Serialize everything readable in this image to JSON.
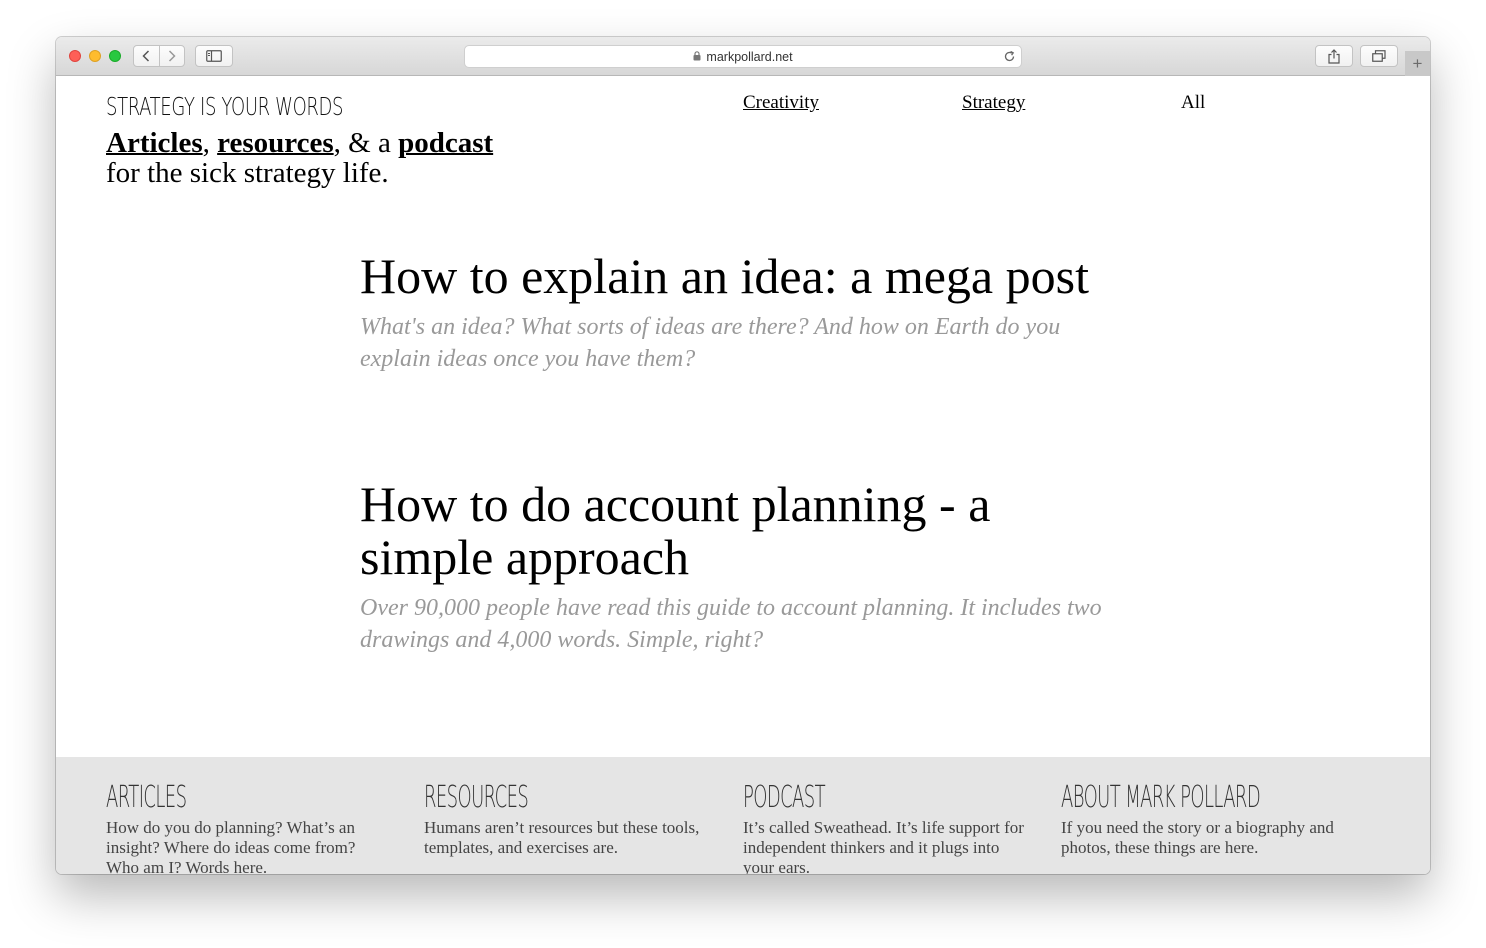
{
  "browser": {
    "url": "markpollard.net"
  },
  "site": {
    "logo": "Strategy is your words",
    "tagline": {
      "link1": "Articles",
      "sep1": ", ",
      "link2": "resources",
      "sep2": ", & a ",
      "link3": "podcast",
      "line2": "for the sick strategy life."
    }
  },
  "nav": {
    "items": [
      {
        "label": "Creativity"
      },
      {
        "label": "Strategy"
      },
      {
        "label": "All"
      }
    ]
  },
  "articles": [
    {
      "title": "How to explain an idea: a mega post",
      "summary": "What's an idea? What sorts of ideas are there? And how on Earth do you explain ideas once you have them?"
    },
    {
      "title": "How to do account planning - a simple approach",
      "summary": "Over 90,000 people have read this guide to account planning. It includes two drawings and 4,000 words. Simple, right?"
    }
  ],
  "footer": {
    "columns": [
      {
        "heading": "Articles",
        "text": "How do you do planning? What’s an insight? Where do ideas come from? Who am I? Words here."
      },
      {
        "heading": "Resources",
        "text": "Humans aren’t resources but these tools, templates, and exercises are."
      },
      {
        "heading": "Podcast",
        "text": "It’s called Sweathead. It’s life support for independent thinkers and it plugs into your ears."
      },
      {
        "heading": "About Mark Pollard",
        "text": "If you need the story or a biography and photos, these things are here."
      }
    ]
  }
}
